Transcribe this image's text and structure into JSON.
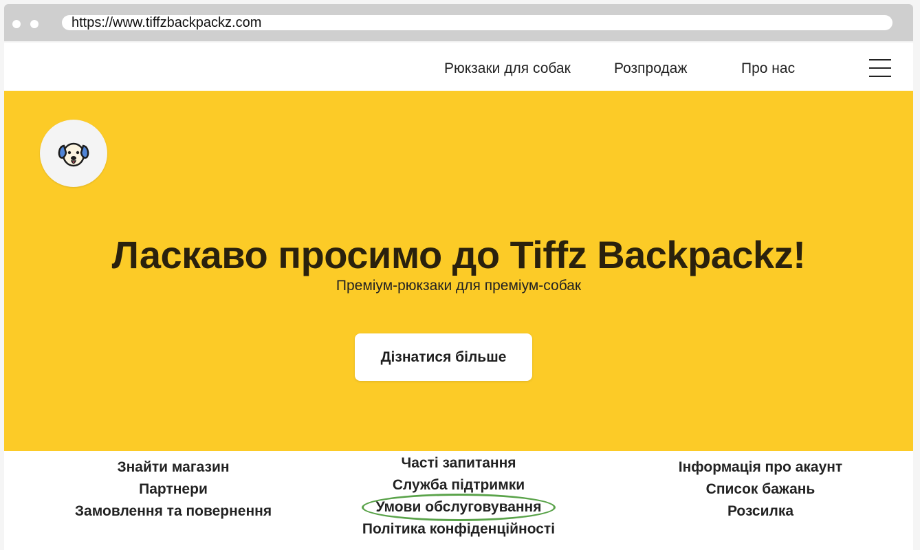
{
  "browser": {
    "url": "https://www.tiffzbackpackz.com"
  },
  "nav": {
    "items": [
      {
        "label": "Рюкзаки для собак"
      },
      {
        "label": "Розпродаж"
      },
      {
        "label": "Про нас"
      }
    ],
    "menu_icon": "hamburger-menu-icon"
  },
  "hero": {
    "logo_icon": "dog-face-icon",
    "title": "Ласкаво просимо до Tiffz Backpackz!",
    "subtitle": "Преміум-рюкзаки для преміум-собак",
    "cta_label": "Дізнатися більше",
    "background_color": "#fccb27"
  },
  "footer": {
    "col1": [
      {
        "label": "Знайти магазин"
      },
      {
        "label": "Партнери"
      },
      {
        "label": "Замовлення та повернення"
      }
    ],
    "col2": [
      {
        "label": "Часті запитання"
      },
      {
        "label": "Служба підтримки"
      },
      {
        "label": "Умови обслуговування"
      },
      {
        "label": "Політика конфіденційності"
      }
    ],
    "col3": [
      {
        "label": "Інформація про акаунт"
      },
      {
        "label": "Список бажань"
      },
      {
        "label": "Розсилка"
      }
    ],
    "highlighted_item": "Умови обслуговування",
    "highlight_color": "#5aa34a"
  }
}
